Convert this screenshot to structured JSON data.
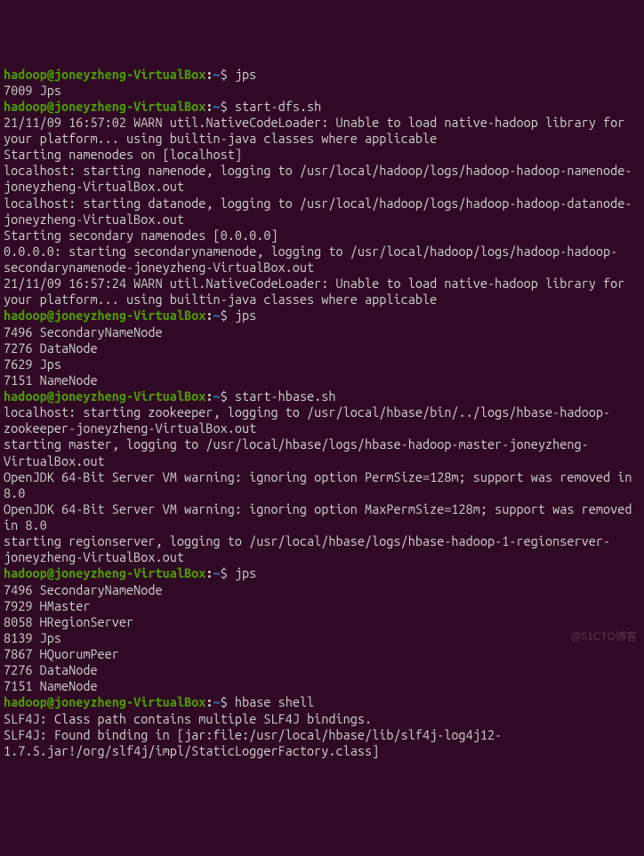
{
  "prompt": {
    "user_host": "hadoop@joneyzheng-VirtualBox",
    "colon": ":",
    "tilde": "~",
    "dollar": "$"
  },
  "blocks": [
    {
      "command": "jps",
      "output": [
        "7009 Jps"
      ]
    },
    {
      "command": "start-dfs.sh",
      "output": [
        "21/11/09 16:57:02 WARN util.NativeCodeLoader: Unable to load native-hadoop library for your platform... using builtin-java classes where applicable",
        "Starting namenodes on [localhost]",
        "localhost: starting namenode, logging to /usr/local/hadoop/logs/hadoop-hadoop-namenode-joneyzheng-VirtualBox.out",
        "localhost: starting datanode, logging to /usr/local/hadoop/logs/hadoop-hadoop-datanode-joneyzheng-VirtualBox.out",
        "Starting secondary namenodes [0.0.0.0]",
        "0.0.0.0: starting secondarynamenode, logging to /usr/local/hadoop/logs/hadoop-hadoop-secondarynamenode-joneyzheng-VirtualBox.out",
        "21/11/09 16:57:24 WARN util.NativeCodeLoader: Unable to load native-hadoop library for your platform... using builtin-java classes where applicable"
      ]
    },
    {
      "command": "jps",
      "output": [
        "7496 SecondaryNameNode",
        "7276 DataNode",
        "7629 Jps",
        "7151 NameNode"
      ]
    },
    {
      "command": "start-hbase.sh",
      "output": [
        "localhost: starting zookeeper, logging to /usr/local/hbase/bin/../logs/hbase-hadoop-zookeeper-joneyzheng-VirtualBox.out",
        "starting master, logging to /usr/local/hbase/logs/hbase-hadoop-master-joneyzheng-VirtualBox.out",
        "OpenJDK 64-Bit Server VM warning: ignoring option PermSize=128m; support was removed in 8.0",
        "OpenJDK 64-Bit Server VM warning: ignoring option MaxPermSize=128m; support was removed in 8.0",
        "starting regionserver, logging to /usr/local/hbase/logs/hbase-hadoop-1-regionserver-joneyzheng-VirtualBox.out"
      ]
    },
    {
      "command": "jps",
      "output": [
        "7496 SecondaryNameNode",
        "7929 HMaster",
        "8058 HRegionServer",
        "8139 Jps",
        "7867 HQuorumPeer",
        "7276 DataNode",
        "7151 NameNode"
      ]
    },
    {
      "command": "hbase shell",
      "output": [
        "SLF4J: Class path contains multiple SLF4J bindings.",
        "SLF4J: Found binding in [jar:file:/usr/local/hbase/lib/slf4j-log4j12-1.7.5.jar!/org/slf4j/impl/StaticLoggerFactory.class]"
      ]
    }
  ],
  "watermark": "@51CTO博客"
}
